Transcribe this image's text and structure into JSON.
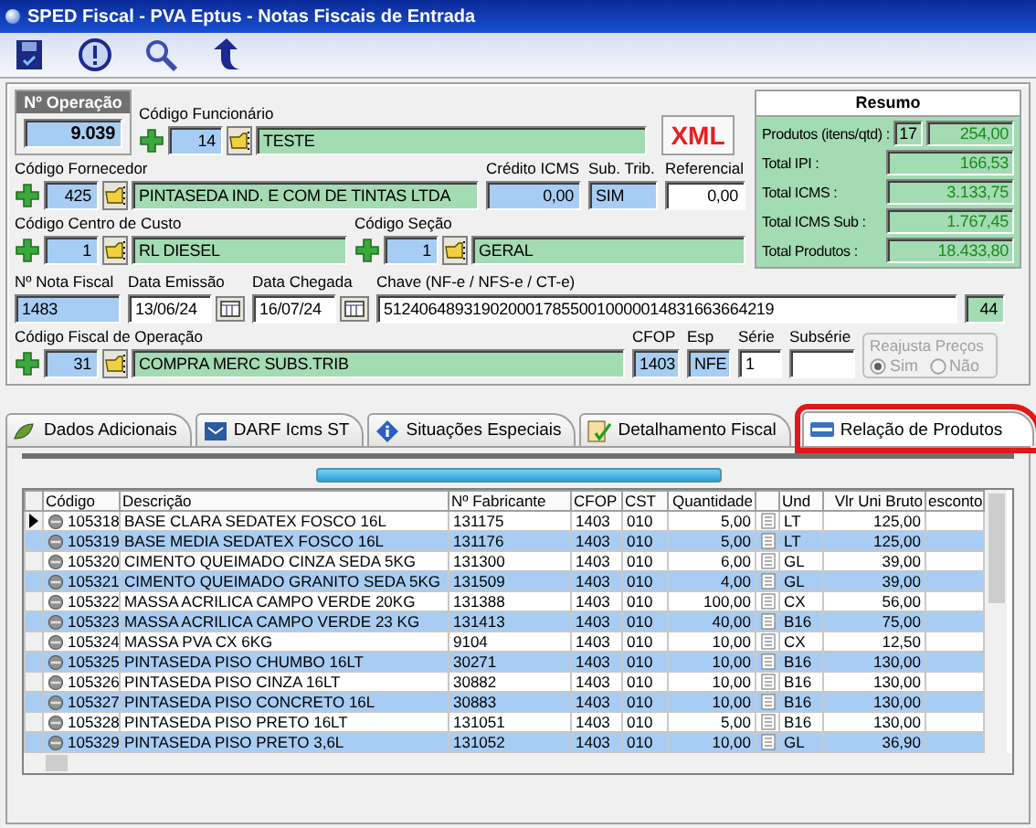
{
  "window": {
    "title": "SPED Fiscal - PVA Eptus - Notas Fiscais de Entrada"
  },
  "operacao": {
    "label": "Nº Operação",
    "value": "9.039"
  },
  "funcionario": {
    "label": "Código Funcionário",
    "code": "14",
    "name": "TESTE"
  },
  "xml_button": "XML",
  "fornecedor": {
    "label": "Código Fornecedor",
    "code": "425",
    "name": "PINTASEDA IND. E COM DE TINTAS LTDA"
  },
  "credito_icms": {
    "label": "Crédito ICMS",
    "value": "0,00"
  },
  "sub_trib": {
    "label": "Sub. Trib.",
    "value": "SIM"
  },
  "referencial": {
    "label": "Referencial",
    "value": "0,00"
  },
  "centro_custo": {
    "label": "Código Centro de Custo",
    "code": "1",
    "name": "RL DIESEL"
  },
  "secao": {
    "label": "Código Seção",
    "code": "1",
    "name": "GERAL"
  },
  "nota_fiscal": {
    "label": "Nº Nota Fiscal",
    "value": "1483"
  },
  "data_emissao": {
    "label": "Data Emissão",
    "value": "13/06/24"
  },
  "data_chegada": {
    "label": "Data Chegada",
    "value": "16/07/24"
  },
  "chave": {
    "label": "Chave (NF-e / NFS-e / CT-e)",
    "value": "51240648931902000178550010000014831663664219",
    "count": "44"
  },
  "cfo": {
    "label": "Código Fiscal de Operação",
    "code": "31",
    "name": "COMPRA MERC SUBS.TRIB"
  },
  "cfop": {
    "label": "CFOP",
    "value": "1403"
  },
  "esp": {
    "label": "Esp",
    "value": "NFE"
  },
  "serie": {
    "label": "Série",
    "value": "1"
  },
  "subserie": {
    "label": "Subsérie"
  },
  "reajusta": {
    "label": "Reajusta Preços",
    "disabled": true,
    "options": [
      {
        "label": "Sim",
        "selected": true
      },
      {
        "label": "Não",
        "selected": false
      }
    ]
  },
  "resumo": {
    "title": "Resumo",
    "rows": [
      {
        "label": "Produtos (itens/qtd) :",
        "values": [
          "17",
          "254,00"
        ]
      },
      {
        "label": "Total IPI :",
        "values": [
          "166,53"
        ]
      },
      {
        "label": "Total ICMS :",
        "values": [
          "3.133,75"
        ]
      },
      {
        "label": "Total ICMS Sub :",
        "values": [
          "1.767,45"
        ]
      },
      {
        "label": "Total Produtos :",
        "values": [
          "18.433,80"
        ]
      }
    ]
  },
  "tabs": [
    {
      "label": "Dados Adicionais",
      "selected": false
    },
    {
      "label": "DARF Icms ST",
      "selected": false
    },
    {
      "label": "Situações Especiais",
      "selected": false
    },
    {
      "label": "Detalhamento Fiscal",
      "selected": false
    },
    {
      "label": "Relação de Produtos",
      "selected": true
    }
  ],
  "table": {
    "columns": [
      "Código",
      "Descrição",
      "Nº Fabricante",
      "CFOP",
      "CST",
      "Quantidade",
      "Und",
      "Vlr Uni Bruto",
      "esconto"
    ],
    "rows": [
      {
        "codigo": "105318",
        "descricao": "BASE CLARA SEDATEX FOSCO 16L",
        "fabricante": "131175",
        "cfop": "1403",
        "cst": "010",
        "quantidade": "5,00",
        "und": "LT",
        "valor": "125,00",
        "selected": true
      },
      {
        "codigo": "105319",
        "descricao": "BASE MEDIA SEDATEX FOSCO 16L",
        "fabricante": "131176",
        "cfop": "1403",
        "cst": "010",
        "quantidade": "5,00",
        "und": "LT",
        "valor": "125,00",
        "selected": false
      },
      {
        "codigo": "105320",
        "descricao": "CIMENTO QUEIMADO CINZA SEDA 5KG",
        "fabricante": "131300",
        "cfop": "1403",
        "cst": "010",
        "quantidade": "6,00",
        "und": "GL",
        "valor": "39,00",
        "selected": false
      },
      {
        "codigo": "105321",
        "descricao": "CIMENTO QUEIMADO GRANITO SEDA 5KG",
        "fabricante": "131509",
        "cfop": "1403",
        "cst": "010",
        "quantidade": "4,00",
        "und": "GL",
        "valor": "39,00",
        "selected": false
      },
      {
        "codigo": "105322",
        "descricao": "MASSA ACRILICA CAMPO VERDE 20KG",
        "fabricante": "131388",
        "cfop": "1403",
        "cst": "010",
        "quantidade": "100,00",
        "und": "CX",
        "valor": "56,00",
        "selected": false
      },
      {
        "codigo": "105323",
        "descricao": "MASSA ACRILICA CAMPO VERDE 23 KG",
        "fabricante": "131413",
        "cfop": "1403",
        "cst": "010",
        "quantidade": "40,00",
        "und": "B16",
        "valor": "75,00",
        "selected": false
      },
      {
        "codigo": "105324",
        "descricao": "MASSA PVA CX 6KG",
        "fabricante": "9104",
        "cfop": "1403",
        "cst": "010",
        "quantidade": "10,00",
        "und": "CX",
        "valor": "12,50",
        "selected": false
      },
      {
        "codigo": "105325",
        "descricao": "PINTASEDA PISO CHUMBO 16LT",
        "fabricante": "30271",
        "cfop": "1403",
        "cst": "010",
        "quantidade": "10,00",
        "und": "B16",
        "valor": "130,00",
        "selected": false
      },
      {
        "codigo": "105326",
        "descricao": "PINTASEDA PISO CINZA 16LT",
        "fabricante": "30882",
        "cfop": "1403",
        "cst": "010",
        "quantidade": "10,00",
        "und": "B16",
        "valor": "130,00",
        "selected": false
      },
      {
        "codigo": "105327",
        "descricao": "PINTASEDA PISO CONCRETO 16L",
        "fabricante": "30883",
        "cfop": "1403",
        "cst": "010",
        "quantidade": "10,00",
        "und": "B16",
        "valor": "130,00",
        "selected": false
      },
      {
        "codigo": "105328",
        "descricao": "PINTASEDA PISO PRETO 16LT",
        "fabricante": "131051",
        "cfop": "1403",
        "cst": "010",
        "quantidade": "5,00",
        "und": "B16",
        "valor": "130,00",
        "selected": false
      },
      {
        "codigo": "105329",
        "descricao": "PINTASEDA PISO PRETO 3,6L",
        "fabricante": "131052",
        "cfop": "1403",
        "cst": "010",
        "quantidade": "10,00",
        "und": "GL",
        "valor": "36,90",
        "selected": false
      }
    ]
  }
}
